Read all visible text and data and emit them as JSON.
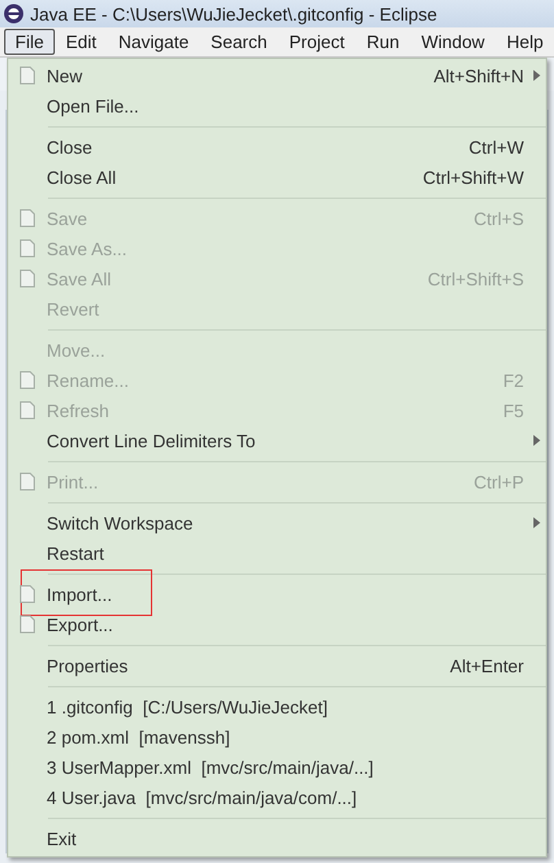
{
  "window": {
    "title": "Java EE - C:\\Users\\WuJieJecket\\.gitconfig - Eclipse"
  },
  "menu_bar": [
    {
      "label": "File",
      "selected": true
    },
    {
      "label": "Edit",
      "selected": false
    },
    {
      "label": "Navigate",
      "selected": false
    },
    {
      "label": "Search",
      "selected": false
    },
    {
      "label": "Project",
      "selected": false
    },
    {
      "label": "Run",
      "selected": false
    },
    {
      "label": "Window",
      "selected": false
    },
    {
      "label": "Help",
      "selected": false
    }
  ],
  "file_menu": {
    "items": [
      {
        "kind": "item",
        "label": "New",
        "shortcut": "Alt+Shift+N",
        "disabled": false,
        "submenu": true,
        "icon": true,
        "highlighted": false
      },
      {
        "kind": "item",
        "label": "Open File...",
        "disabled": false,
        "submenu": false,
        "icon": false,
        "highlighted": false
      },
      {
        "kind": "separator"
      },
      {
        "kind": "item",
        "label": "Close",
        "shortcut": "Ctrl+W",
        "disabled": false,
        "submenu": false,
        "icon": false,
        "highlighted": false
      },
      {
        "kind": "item",
        "label": "Close All",
        "shortcut": "Ctrl+Shift+W",
        "disabled": false,
        "submenu": false,
        "icon": false,
        "highlighted": false
      },
      {
        "kind": "separator"
      },
      {
        "kind": "item",
        "label": "Save",
        "shortcut": "Ctrl+S",
        "disabled": true,
        "submenu": false,
        "icon": true,
        "highlighted": false
      },
      {
        "kind": "item",
        "label": "Save As...",
        "disabled": true,
        "submenu": false,
        "icon": true,
        "highlighted": false
      },
      {
        "kind": "item",
        "label": "Save All",
        "shortcut": "Ctrl+Shift+S",
        "disabled": true,
        "submenu": false,
        "icon": true,
        "highlighted": false
      },
      {
        "kind": "item",
        "label": "Revert",
        "disabled": true,
        "submenu": false,
        "icon": false,
        "highlighted": false
      },
      {
        "kind": "separator"
      },
      {
        "kind": "item",
        "label": "Move...",
        "disabled": true,
        "submenu": false,
        "icon": false,
        "highlighted": false
      },
      {
        "kind": "item",
        "label": "Rename...",
        "shortcut": "F2",
        "disabled": true,
        "submenu": false,
        "icon": true,
        "highlighted": false
      },
      {
        "kind": "item",
        "label": "Refresh",
        "shortcut": "F5",
        "disabled": true,
        "submenu": false,
        "icon": true,
        "highlighted": false
      },
      {
        "kind": "item",
        "label": "Convert Line Delimiters To",
        "disabled": false,
        "submenu": true,
        "icon": false,
        "highlighted": false
      },
      {
        "kind": "separator"
      },
      {
        "kind": "item",
        "label": "Print...",
        "shortcut": "Ctrl+P",
        "disabled": true,
        "submenu": false,
        "icon": true,
        "highlighted": false
      },
      {
        "kind": "separator"
      },
      {
        "kind": "item",
        "label": "Switch Workspace",
        "disabled": false,
        "submenu": true,
        "icon": false,
        "highlighted": false
      },
      {
        "kind": "item",
        "label": "Restart",
        "disabled": false,
        "submenu": false,
        "icon": false,
        "highlighted": false
      },
      {
        "kind": "separator"
      },
      {
        "kind": "item",
        "label": "Import...",
        "disabled": false,
        "submenu": false,
        "icon": true,
        "highlighted": true
      },
      {
        "kind": "item",
        "label": "Export...",
        "disabled": false,
        "submenu": false,
        "icon": true,
        "highlighted": false
      },
      {
        "kind": "separator"
      },
      {
        "kind": "item",
        "label": "Properties",
        "shortcut": "Alt+Enter",
        "disabled": false,
        "submenu": false,
        "icon": false,
        "highlighted": false
      },
      {
        "kind": "separator"
      },
      {
        "kind": "recent",
        "label": "1 .gitconfig",
        "location": "[C:/Users/WuJieJecket]"
      },
      {
        "kind": "recent",
        "label": "2 pom.xml",
        "location": "[mavenssh]"
      },
      {
        "kind": "recent",
        "label": "3 UserMapper.xml",
        "location": "[mvc/src/main/java/...]"
      },
      {
        "kind": "recent",
        "label": "4 User.java",
        "location": "[mvc/src/main/java/com/...]"
      },
      {
        "kind": "separator"
      },
      {
        "kind": "item",
        "label": "Exit",
        "disabled": false,
        "submenu": false,
        "icon": false,
        "highlighted": false
      }
    ]
  }
}
